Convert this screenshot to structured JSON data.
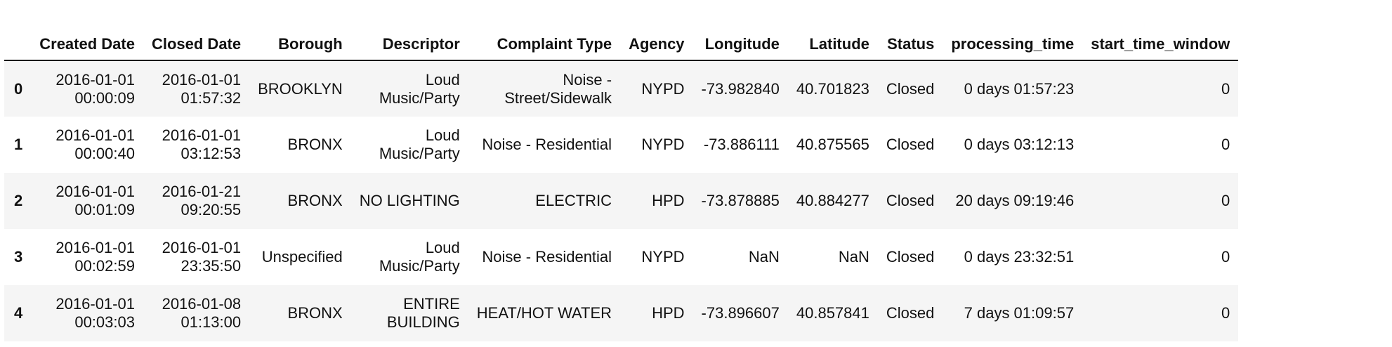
{
  "columns": [
    "Created Date",
    "Closed Date",
    "Borough",
    "Descriptor",
    "Complaint Type",
    "Agency",
    "Longitude",
    "Latitude",
    "Status",
    "processing_time",
    "start_time_window"
  ],
  "rows": [
    {
      "index": "0",
      "created": [
        "2016-01-01",
        "00:00:09"
      ],
      "closed": [
        "2016-01-01",
        "01:57:32"
      ],
      "borough": "BROOKLYN",
      "descriptor": [
        "Loud",
        "Music/Party"
      ],
      "complaint": [
        "Noise -",
        "Street/Sidewalk"
      ],
      "agency": "NYPD",
      "longitude": "-73.982840",
      "latitude": "40.701823",
      "status": "Closed",
      "processing_time": "0 days 01:57:23",
      "start_time_window": "0"
    },
    {
      "index": "1",
      "created": [
        "2016-01-01",
        "00:00:40"
      ],
      "closed": [
        "2016-01-01",
        "03:12:53"
      ],
      "borough": "BRONX",
      "descriptor": [
        "Loud",
        "Music/Party"
      ],
      "complaint": [
        "Noise - Residential",
        ""
      ],
      "agency": "NYPD",
      "longitude": "-73.886111",
      "latitude": "40.875565",
      "status": "Closed",
      "processing_time": "0 days 03:12:13",
      "start_time_window": "0"
    },
    {
      "index": "2",
      "created": [
        "2016-01-01",
        "00:01:09"
      ],
      "closed": [
        "2016-01-21",
        "09:20:55"
      ],
      "borough": "BRONX",
      "descriptor": [
        "NO LIGHTING",
        ""
      ],
      "complaint": [
        "ELECTRIC",
        ""
      ],
      "agency": "HPD",
      "longitude": "-73.878885",
      "latitude": "40.884277",
      "status": "Closed",
      "processing_time": "20 days 09:19:46",
      "start_time_window": "0"
    },
    {
      "index": "3",
      "created": [
        "2016-01-01",
        "00:02:59"
      ],
      "closed": [
        "2016-01-01",
        "23:35:50"
      ],
      "borough": "Unspecified",
      "descriptor": [
        "Loud",
        "Music/Party"
      ],
      "complaint": [
        "Noise - Residential",
        ""
      ],
      "agency": "NYPD",
      "longitude": "NaN",
      "latitude": "NaN",
      "status": "Closed",
      "processing_time": "0 days 23:32:51",
      "start_time_window": "0"
    },
    {
      "index": "4",
      "created": [
        "2016-01-01",
        "00:03:03"
      ],
      "closed": [
        "2016-01-08",
        "01:13:00"
      ],
      "borough": "BRONX",
      "descriptor": [
        "ENTIRE",
        "BUILDING"
      ],
      "complaint": [
        "HEAT/HOT WATER",
        ""
      ],
      "agency": "HPD",
      "longitude": "-73.896607",
      "latitude": "40.857841",
      "status": "Closed",
      "processing_time": "7 days 01:09:57",
      "start_time_window": "0"
    }
  ]
}
